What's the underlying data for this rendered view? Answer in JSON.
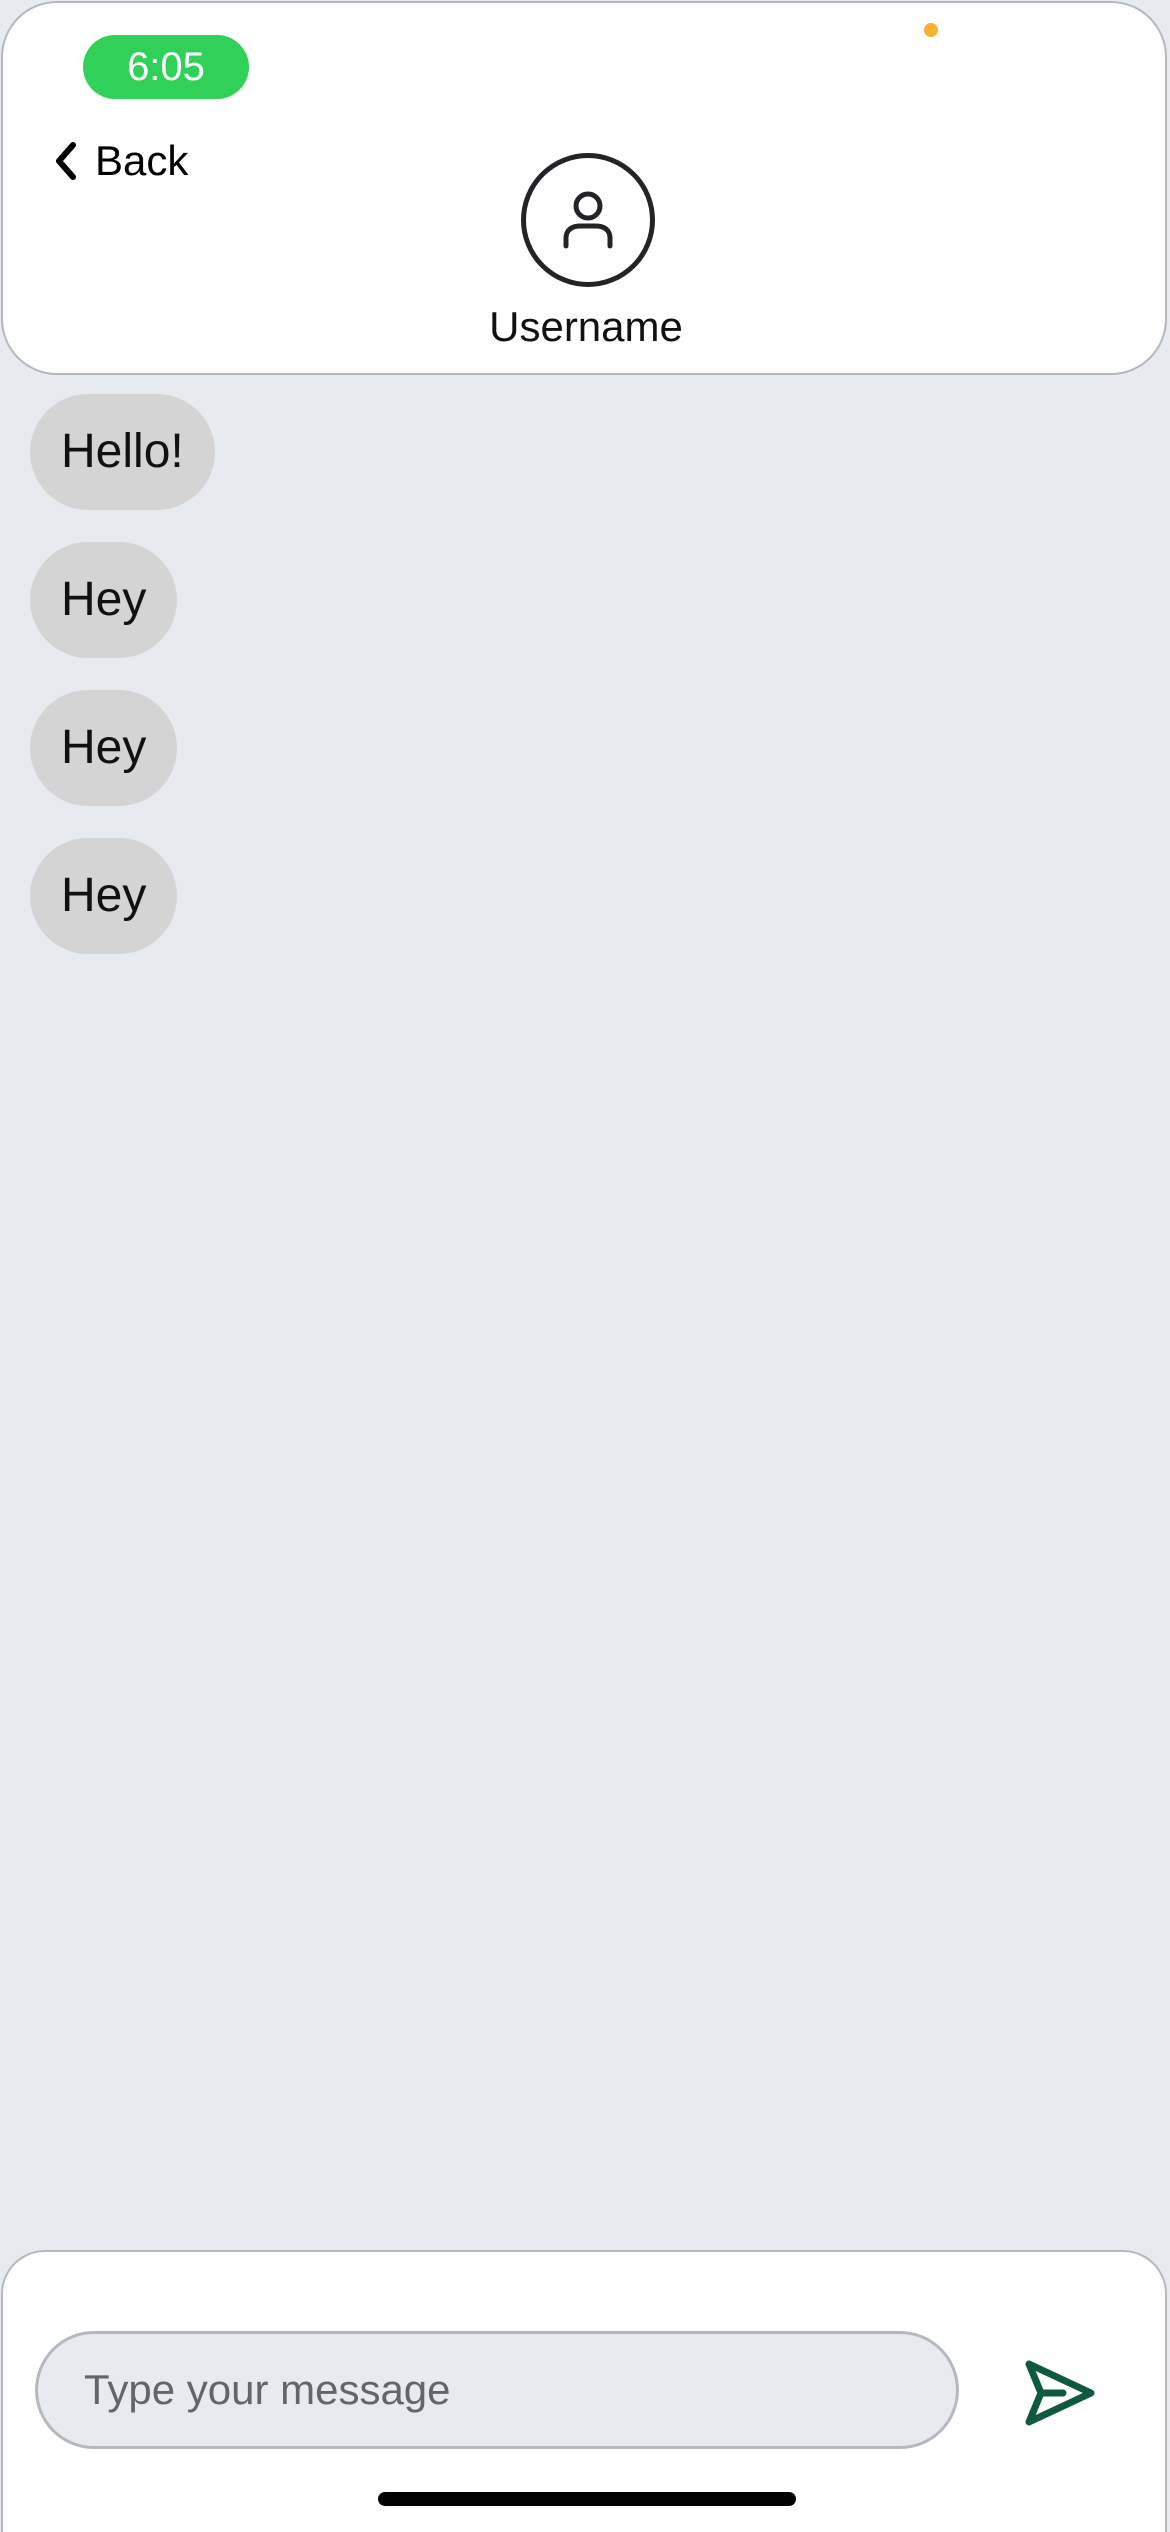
{
  "status_bar": {
    "time": "6:05",
    "time_pill_color": "#30d158",
    "indicator_dot_color": "#f7b236"
  },
  "header": {
    "back_label": "Back",
    "back_icon": "chevron-left-icon",
    "avatar_icon": "user-icon",
    "username": "Username"
  },
  "messages": [
    {
      "text": "Hello!"
    },
    {
      "text": "Hey"
    },
    {
      "text": "Hey"
    },
    {
      "text": "Hey"
    }
  ],
  "composer": {
    "placeholder": "Type your message",
    "value": "",
    "send_icon": "send-icon",
    "send_color": "#0f5a3f"
  }
}
